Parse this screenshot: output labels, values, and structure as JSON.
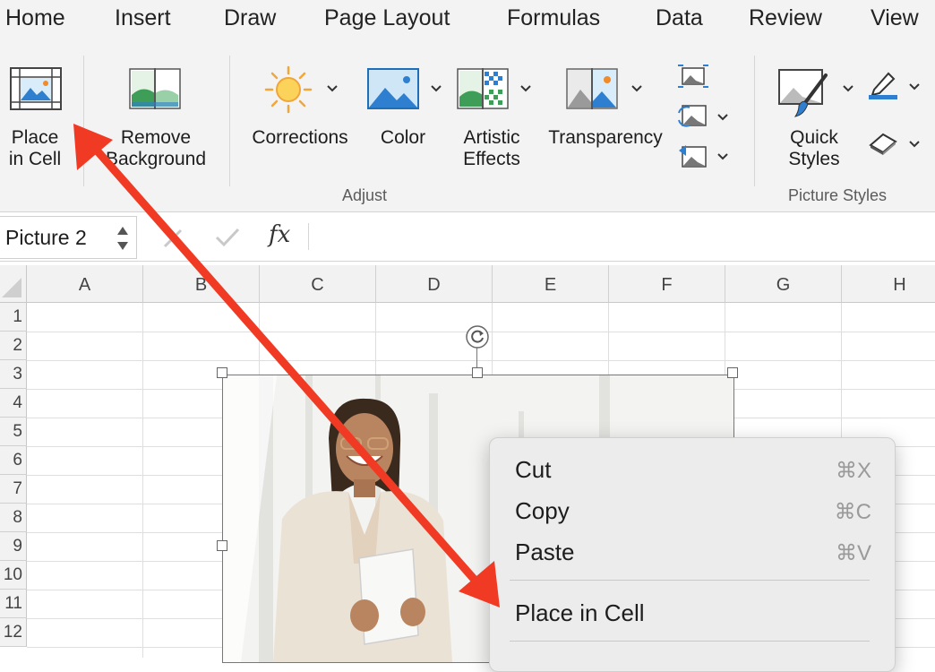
{
  "tabs": [
    "Home",
    "Insert",
    "Draw",
    "Page Layout",
    "Formulas",
    "Data",
    "Review",
    "View"
  ],
  "ribbon": {
    "place_in_cell": "Place\nin Cell",
    "remove_background": "Remove\nBackground",
    "corrections": "Corrections",
    "color": "Color",
    "artistic_effects": "Artistic\nEffects",
    "transparency": "Transparency",
    "quick_styles": "Quick\nStyles",
    "group_adjust": "Adjust",
    "group_picture_styles": "Picture Styles"
  },
  "formula_bar": {
    "name_box": "Picture 2",
    "fx": "fx",
    "formula": ""
  },
  "grid": {
    "columns": [
      "A",
      "B",
      "C",
      "D",
      "E",
      "F",
      "G",
      "H"
    ],
    "rows": [
      "1",
      "2",
      "3",
      "4",
      "5",
      "6",
      "7",
      "8",
      "9",
      "10",
      "11",
      "12"
    ]
  },
  "context_menu": {
    "items": [
      {
        "label": "Cut",
        "shortcut": "⌘X"
      },
      {
        "label": "Copy",
        "shortcut": "⌘C"
      },
      {
        "label": "Paste",
        "shortcut": "⌘V"
      },
      {
        "label": "Place in Cell",
        "shortcut": ""
      }
    ]
  },
  "colors": {
    "arrow": "#f03a24",
    "ribbon_bg": "#f3f3f3",
    "menu_bg": "#ececec"
  }
}
